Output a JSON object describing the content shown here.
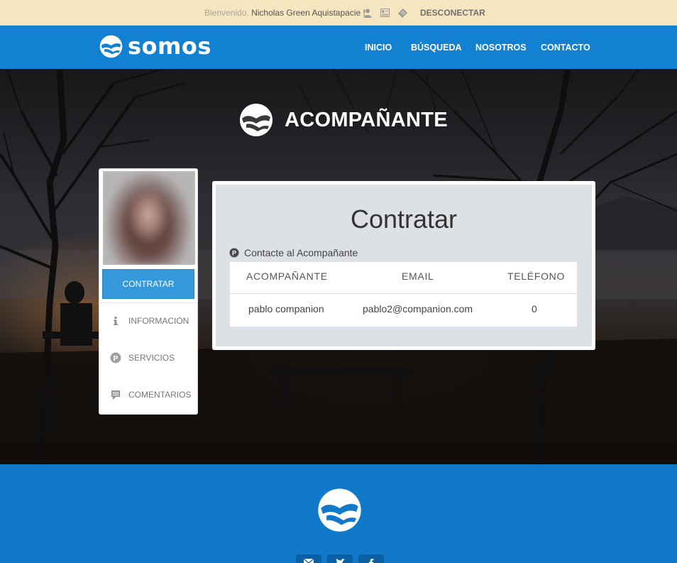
{
  "topbar": {
    "greeting": "Bienvenido,",
    "user_name": "Nicholas Green Aquistapacie !",
    "icons": [
      "user-icon",
      "profile-card-icon",
      "ticket-icon"
    ],
    "logout_label": "DESCONECTAR"
  },
  "navbar": {
    "brand": "somos",
    "items": [
      {
        "label": "INICIO"
      },
      {
        "label": "BÚSQUEDA"
      },
      {
        "label": "NOSOTROS"
      },
      {
        "label": "CONTACTO"
      }
    ]
  },
  "hero": {
    "title": "ACOMPAÑANTE"
  },
  "sidebar": {
    "hire_label": "CONTRATAR",
    "items": [
      {
        "label": "INFORMACIÓN",
        "icon": "info-icon"
      },
      {
        "label": "SERVICIOS",
        "icon": "services-icon"
      },
      {
        "label": "COMENTARIOS",
        "icon": "comments-icon"
      }
    ]
  },
  "panel": {
    "title": "Contratar",
    "note": "Contacte al Acompañante",
    "table": {
      "headers": [
        "ACOMPAÑANTE",
        "EMAIL",
        "TELÉFONO"
      ],
      "rows": [
        [
          "pablo companion",
          "pablo2@companion.com",
          "0"
        ]
      ]
    }
  },
  "footer": {
    "social": [
      "email-icon",
      "twitter-icon",
      "facebook-icon"
    ]
  },
  "colors": {
    "topbar_bg": "#f6e6bf",
    "navbar_bg": "#1381d1",
    "footer_bg": "#1079c9",
    "button_blue": "#3498db"
  }
}
